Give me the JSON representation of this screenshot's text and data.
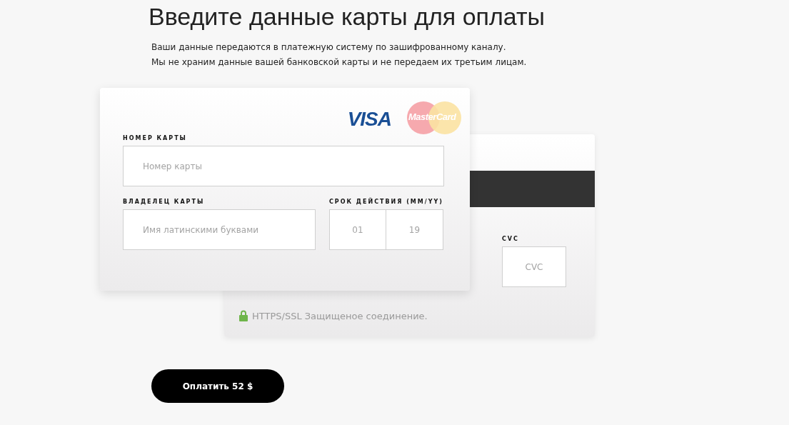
{
  "title": "Введите данные карты для оплаты",
  "notes": [
    "Ваши данные передаются в платежную систему по зашифрованному каналу.",
    "Мы не храним данные вашей банковской карты и не передаем их третьим лицам."
  ],
  "front_card": {
    "logos": [
      {
        "kind": "visa",
        "text": "VISA"
      },
      {
        "kind": "mastercard",
        "text": "MasterCard"
      }
    ],
    "card_number": {
      "label": "НОМЕР КАРТЫ",
      "placeholder": "Номер карты"
    },
    "holder": {
      "label": "ВЛАДЕЛЕЦ КАРТЫ",
      "placeholder": "Имя латинскими буквами"
    },
    "expiry": {
      "label": "СРОК ДЕЙСТВИЯ (MM/YY)",
      "month_placeholder": "01",
      "year_placeholder": "19"
    }
  },
  "back_card": {
    "cvc": {
      "label": "CVC",
      "placeholder": "CVC"
    },
    "secure_note": "HTTPS/SSL Защищеное соединение."
  },
  "pay_button": "Оплатить 52 $"
}
